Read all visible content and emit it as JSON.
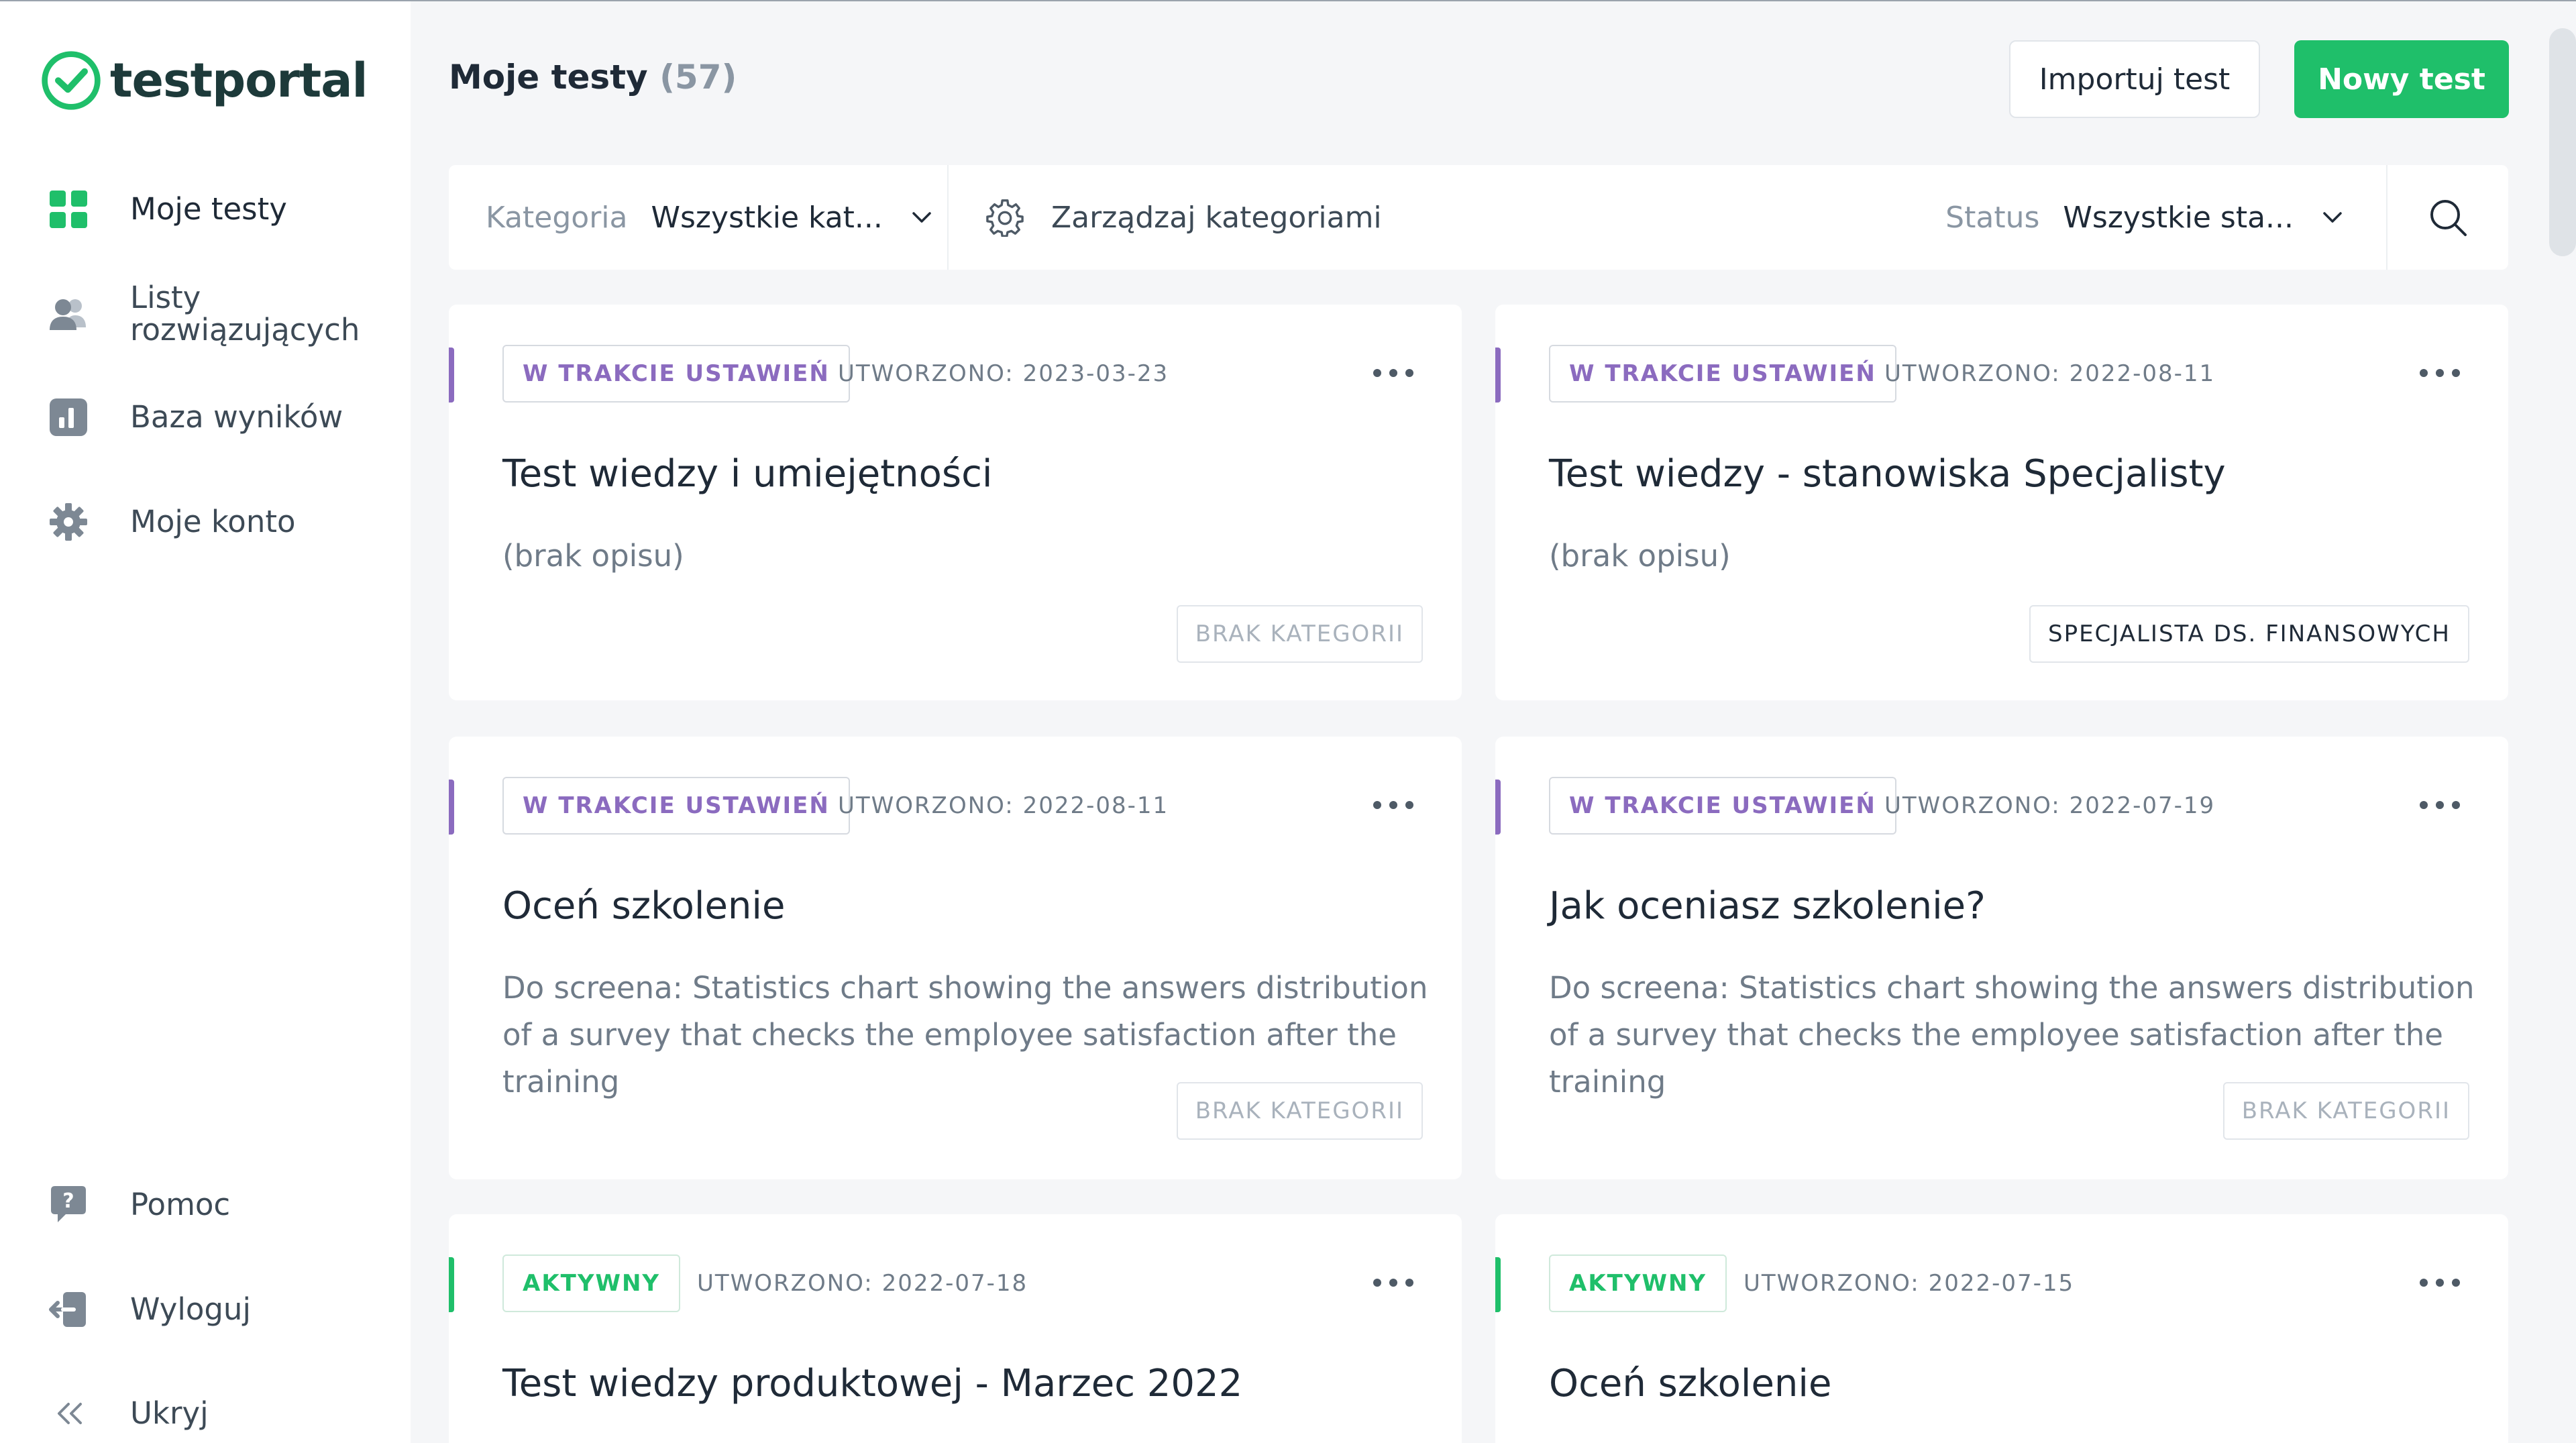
{
  "app": {
    "brand": "testportal"
  },
  "sidebar": {
    "items": [
      {
        "label": "Moje testy"
      },
      {
        "label": "Listy rozwiązujących"
      },
      {
        "label": "Baza wyników"
      },
      {
        "label": "Moje konto"
      }
    ],
    "bottom": [
      {
        "label": "Pomoc"
      },
      {
        "label": "Wyloguj"
      },
      {
        "label": "Ukryj"
      }
    ]
  },
  "header": {
    "title": "Moje testy",
    "count": "(57)",
    "import_label": "Importuj test",
    "new_label": "Nowy test"
  },
  "filters": {
    "category_label": "Kategoria",
    "category_value": "Wszystkie kat...",
    "manage_label": "Zarządzaj kategoriami",
    "status_label": "Status",
    "status_value": "Wszystkie sta..."
  },
  "cards": [
    {
      "status": "W TRAKCIE USTAWIEŃ",
      "created": "UTWORZONO: 2023-03-23",
      "title": "Test wiedzy i umiejętności",
      "description": "(brak opisu)",
      "category": "BRAK KATEGORII"
    },
    {
      "status": "W TRAKCIE USTAWIEŃ",
      "created": "UTWORZONO: 2022-08-11",
      "title": "Test wiedzy - stanowiska Specjalisty",
      "description": "(brak opisu)",
      "category": "SPECJALISTA DS. FINANSOWYCH"
    },
    {
      "status": "W TRAKCIE USTAWIEŃ",
      "created": "UTWORZONO: 2022-08-11",
      "title": "Oceń szkolenie",
      "description": "Do screena: Statistics chart showing the answers distribution of a survey that checks the employee satisfaction after the training",
      "category": "BRAK KATEGORII"
    },
    {
      "status": "W TRAKCIE USTAWIEŃ",
      "created": "UTWORZONO: 2022-07-19",
      "title": "Jak oceniasz szkolenie?",
      "description": "Do screena: Statistics chart showing the answers distribution of a survey that checks the employee satisfaction after the training",
      "category": "BRAK KATEGORII"
    },
    {
      "status": "AKTYWNY",
      "created": "UTWORZONO: 2022-07-18",
      "title": "Test wiedzy produktowej - Marzec 2022"
    },
    {
      "status": "AKTYWNY",
      "created": "UTWORZONO: 2022-07-15",
      "title": "Oceń szkolenie"
    }
  ],
  "colors": {
    "brand_green": "#1fbf6a",
    "setup_purple": "#8b6bbf",
    "active_green": "#1fbf6a"
  }
}
